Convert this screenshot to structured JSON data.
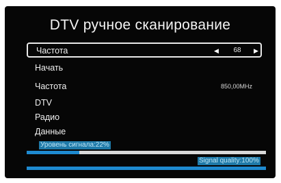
{
  "screen": {
    "title": "DTV ручное сканирование"
  },
  "menu": {
    "items": [
      {
        "label": "Частота",
        "value": "68",
        "left_arrow": "◀",
        "right_arrow": "▶",
        "selected": true
      },
      {
        "label": "Начать"
      },
      {
        "label": "Частота",
        "value": "850,00MHz"
      },
      {
        "label": "DTV"
      },
      {
        "label": "Радио"
      },
      {
        "label": "Данные"
      }
    ]
  },
  "signal": {
    "level_label": "Уровень сигнала:22%",
    "level_percent": 22,
    "quality_label": "Signal quality:100%",
    "quality_percent": 100
  },
  "colors": {
    "background": "#060606",
    "text": "#f2f2f2",
    "bar_fill": "#1e8ad0",
    "bar_track": "#d9d9d9",
    "label_bg": "#1f7aa9"
  }
}
